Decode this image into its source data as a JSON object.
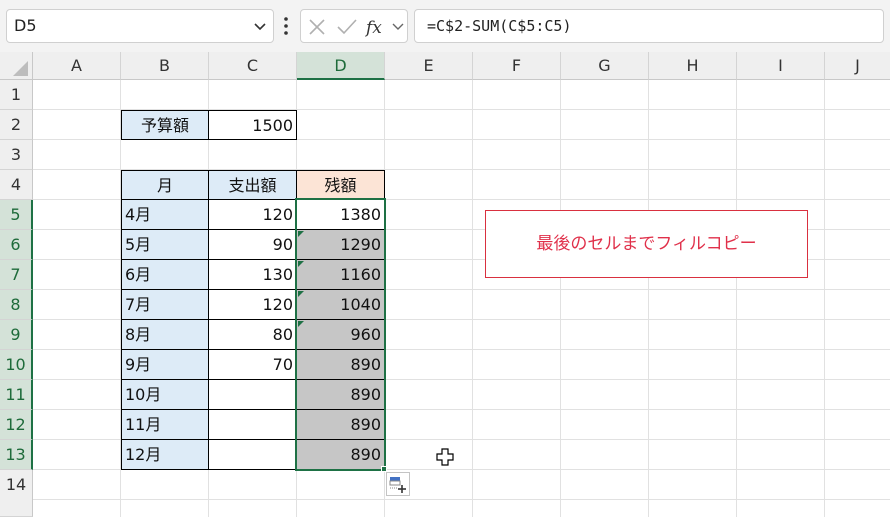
{
  "name_box": {
    "value": "D5"
  },
  "formula_bar": {
    "formula": "=C$2-SUM(C$5:C5)"
  },
  "columns": [
    "A",
    "B",
    "C",
    "D",
    "E",
    "F",
    "G",
    "H",
    "I",
    "J"
  ],
  "rows": [
    "1",
    "2",
    "3",
    "4",
    "5",
    "6",
    "7",
    "8",
    "9",
    "10",
    "11",
    "12",
    "13",
    "14"
  ],
  "selected_column": "D",
  "budget": {
    "label": "予算額",
    "value": "1500"
  },
  "table": {
    "headers": {
      "month": "月",
      "expense": "支出額",
      "balance": "残額"
    },
    "rows": [
      {
        "month": "4月",
        "expense": "120",
        "balance": "1380"
      },
      {
        "month": "5月",
        "expense": "90",
        "balance": "1290"
      },
      {
        "month": "6月",
        "expense": "130",
        "balance": "1160"
      },
      {
        "month": "7月",
        "expense": "120",
        "balance": "1040"
      },
      {
        "month": "8月",
        "expense": "80",
        "balance": "960"
      },
      {
        "month": "9月",
        "expense": "70",
        "balance": "890"
      },
      {
        "month": "10月",
        "expense": "",
        "balance": "890"
      },
      {
        "month": "11月",
        "expense": "",
        "balance": "890"
      },
      {
        "month": "12月",
        "expense": "",
        "balance": "890"
      }
    ]
  },
  "annotation": {
    "text": "最後のセルまでフィルコピー"
  },
  "colors": {
    "header_fill": "#ddebf7",
    "balance_header_fill": "#fce4d6",
    "selection_fill": "#c6c6c6",
    "selection_border": "#1e7145",
    "annotation_color": "#e0304a"
  },
  "icons": {
    "name_box_dropdown": "chevron-down-icon",
    "cancel": "close-icon",
    "enter": "check-icon",
    "insert_function": "fx-icon",
    "autofill_options": "autofill-options-icon",
    "cursor": "crosshair-cursor-icon"
  }
}
